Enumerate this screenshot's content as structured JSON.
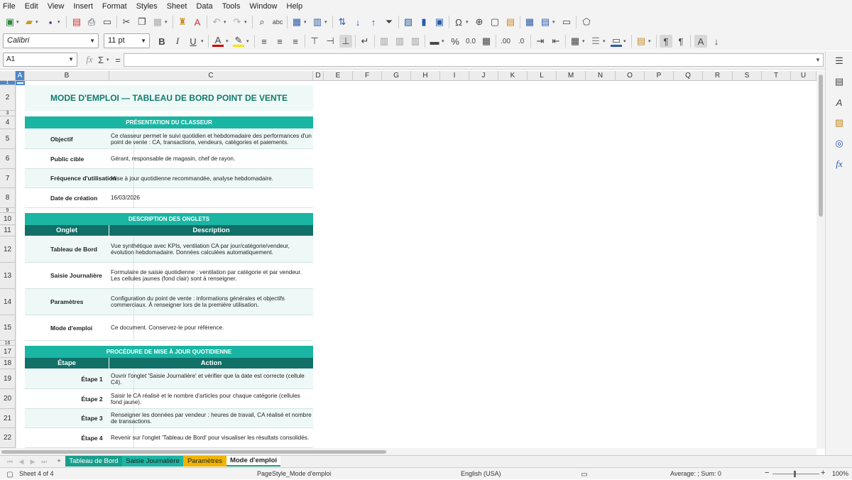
{
  "menu": [
    "File",
    "Edit",
    "View",
    "Insert",
    "Format",
    "Styles",
    "Sheet",
    "Data",
    "Tools",
    "Window",
    "Help"
  ],
  "toolbar": {
    "font_name": "Calibri",
    "font_size": "11 pt"
  },
  "formula_bar": {
    "cell_ref": "A1",
    "fx": "fx",
    "sigma": "Σ",
    "equals": "=",
    "content": ""
  },
  "columns": [
    "A",
    "B",
    "C",
    "D",
    "E",
    "F",
    "G",
    "H",
    "I",
    "J",
    "K",
    "L",
    "M",
    "N",
    "O",
    "P",
    "Q",
    "R",
    "S",
    "T",
    "U"
  ],
  "rows": [
    "1",
    "2",
    "3",
    "4",
    "5",
    "6",
    "7",
    "8",
    "9",
    "10",
    "11",
    "12",
    "13",
    "14",
    "15",
    "16",
    "17",
    "18",
    "19",
    "20",
    "21",
    "22"
  ],
  "sheet": {
    "title": "MODE D'EMPLOI — TABLEAU DE BORD POINT DE VENTE",
    "section1": "PRÉSENTATION DU CLASSEUR",
    "presentation": [
      {
        "label": "Objectif",
        "value": "Ce classeur permet le suivi quotidien et hebdomadaire des performances d'un point de vente : CA, transactions, vendeurs, catégories et paiements."
      },
      {
        "label": "Public cible",
        "value": "Gérant, responsable de magasin, chef de rayon."
      },
      {
        "label": "Fréquence d'utilisation",
        "value": "Mise à jour quotidienne recommandée, analyse hebdomadaire."
      },
      {
        "label": "Date de création",
        "value": "16/03/2026"
      }
    ],
    "section2": "DESCRIPTION DES ONGLETS",
    "tabs_header": {
      "col1": "Onglet",
      "col2": "Description"
    },
    "tabs_desc": [
      {
        "label": "Tableau de Bord",
        "value": "Vue synthétique avec KPIs, ventilation CA par jour/catégorie/vendeur, évolution hebdomadaire. Données calculées automatiquement."
      },
      {
        "label": "Saisie Journalière",
        "value": "Formulaire de saisie quotidienne : ventilation par catégorie et par vendeur. Les cellules jaunes (fond clair) sont à renseigner."
      },
      {
        "label": "Paramètres",
        "value": "Configuration du point de vente : informations générales et objectifs commerciaux. À renseigner lors de la première utilisation."
      },
      {
        "label": "Mode d'emploi",
        "value": "Ce document. Conservez-le pour référence."
      }
    ],
    "section3": "PROCÉDURE DE MISE À JOUR QUOTIDIENNE",
    "steps_header": {
      "col1": "Étape",
      "col2": "Action"
    },
    "steps": [
      {
        "label": "Étape 1",
        "value": "Ouvrir l'onglet 'Saisie Journalière' et vérifier que la date est correcte (cellule C4)."
      },
      {
        "label": "Étape 2",
        "value": "Saisir le CA réalisé et le nombre d'articles pour chaque catégorie (cellules fond jaune)."
      },
      {
        "label": "Étape 3",
        "value": "Renseigner les données par vendeur : heures de travail, CA réalisé et nombre de transactions."
      },
      {
        "label": "Étape 4",
        "value": "Revenir sur l'onglet 'Tableau de Bord' pour visualiser les résultats consolidés."
      }
    ]
  },
  "sheet_tabs": [
    {
      "label": "Tableau de Bord",
      "color": "#1a9e8c"
    },
    {
      "label": "Saisie Journalière",
      "color": "#1ab5a3"
    },
    {
      "label": "Paramètres",
      "color": "#f0b400"
    },
    {
      "label": "Mode d'emploi",
      "color": "#ffffff"
    }
  ],
  "tab_add": "+",
  "status": {
    "sheet": "Sheet 4 of 4",
    "page_style": "PageStyle_Mode d'emploi",
    "language": "English (USA)",
    "summary": "Average: ; Sum: 0",
    "zoom": "100%"
  },
  "colors": {
    "accent": "#1ab5a3",
    "header_dark": "#117068",
    "title_text": "#117b6e"
  }
}
